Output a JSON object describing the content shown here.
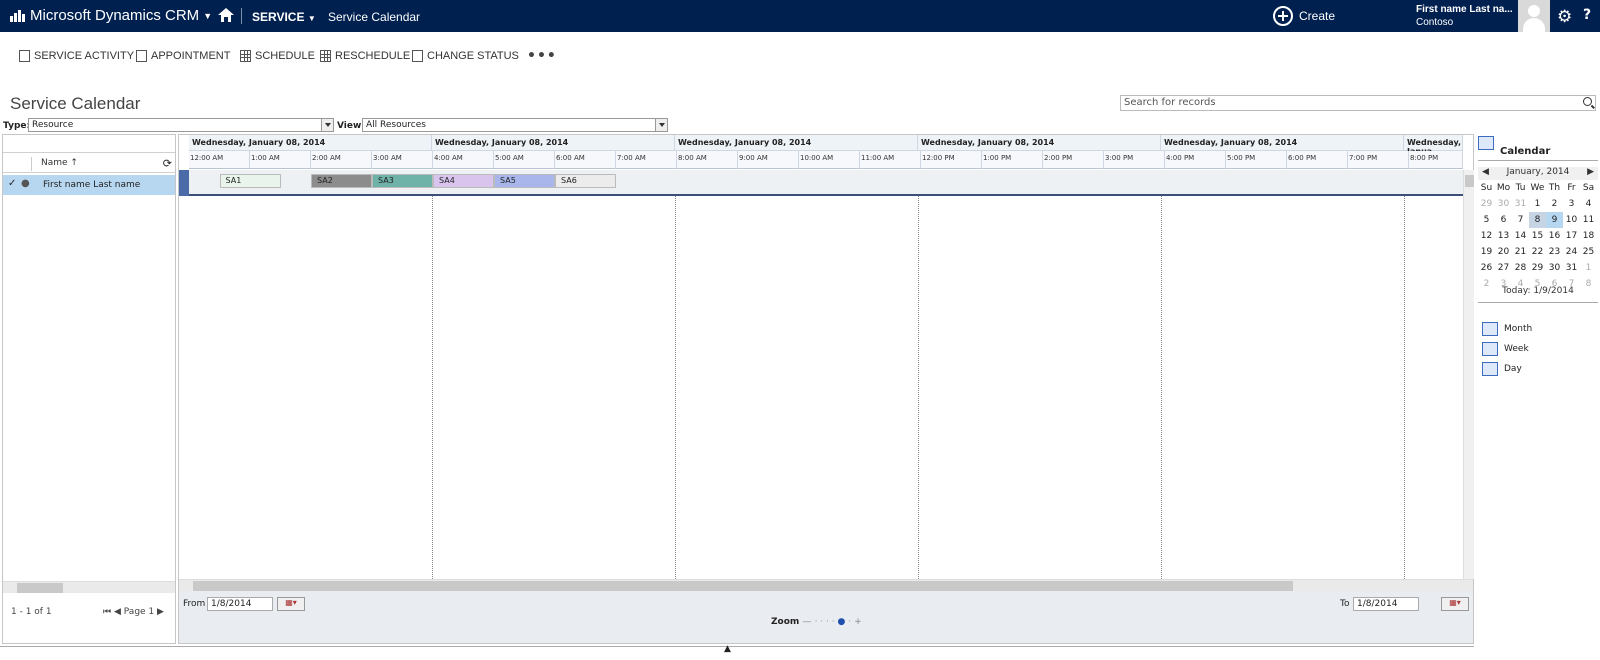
{
  "nav": {
    "brand": "Microsoft Dynamics CRM",
    "area": "SERVICE",
    "page": "Service Calendar",
    "create": "Create",
    "user_name": "First name Last na...",
    "org": "Contoso",
    "help": "?"
  },
  "toolbar": {
    "service_activity": "SERVICE ACTIVITY",
    "appointment": "APPOINTMENT",
    "schedule": "SCHEDULE",
    "reschedule": "RESCHEDULE",
    "change_status": "CHANGE STATUS",
    "more": "•••"
  },
  "page_title": "Service Calendar",
  "search": {
    "placeholder": "Search for records"
  },
  "filters": {
    "type_label": "Type:",
    "type_value": "Resource",
    "view_label": "View:",
    "view_value": "All Resources"
  },
  "resources": {
    "column": "Name ↑",
    "rows": [
      "First name Last name"
    ],
    "count": "1 - 1 of 1",
    "page": "Page 1"
  },
  "calendar": {
    "day_headers": [
      "Wednesday, January 08, 2014",
      "Wednesday, January 08, 2014",
      "Wednesday, January 08, 2014",
      "Wednesday, January 08, 2014",
      "Wednesday, January 08, 2014",
      "Wednesday, Janua"
    ],
    "hours": [
      "12:00 AM",
      "1:00 AM",
      "2:00 AM",
      "3:00 AM",
      "4:00 AM",
      "5:00 AM",
      "6:00 AM",
      "7:00 AM",
      "8:00 AM",
      "9:00 AM",
      "10:00 AM",
      "11:00 AM",
      "12:00 PM",
      "1:00 PM",
      "2:00 PM",
      "3:00 PM",
      "4:00 PM",
      "5:00 PM",
      "6:00 PM",
      "7:00 PM",
      "8:00 PM",
      "9:0"
    ],
    "activities": [
      "SA1",
      "SA2",
      "SA3",
      "SA4",
      "SA5",
      "SA6"
    ],
    "activity_colors": [
      "#e8f4ec",
      "#8c8c8c",
      "#6fb2a7",
      "#d9c4ee",
      "#a8b6ec",
      "#ececec"
    ],
    "from_label": "From",
    "from_value": "1/8/2014",
    "to_label": "To",
    "to_value": "1/8/2014",
    "zoom_label": "Zoom"
  },
  "mini_calendar": {
    "title": "Calendar",
    "month": "January, 2014",
    "weekdays": [
      "Su",
      "Mo",
      "Tu",
      "We",
      "Th",
      "Fr",
      "Sa"
    ],
    "days": [
      [
        "29",
        "30",
        "31",
        "1",
        "2",
        "3",
        "4"
      ],
      [
        "5",
        "6",
        "7",
        "8",
        "9",
        "10",
        "11"
      ],
      [
        "12",
        "13",
        "14",
        "15",
        "16",
        "17",
        "18"
      ],
      [
        "19",
        "20",
        "21",
        "22",
        "23",
        "24",
        "25"
      ],
      [
        "26",
        "27",
        "28",
        "29",
        "30",
        "31",
        "1"
      ],
      [
        "2",
        "3",
        "4",
        "5",
        "6",
        "7",
        "8"
      ]
    ],
    "today": "Today: 1/9/2014",
    "views": [
      "Month",
      "Week",
      "Day"
    ]
  },
  "colors": {
    "nav_bg": "#002050",
    "selected_row": "#b7d7f1"
  }
}
